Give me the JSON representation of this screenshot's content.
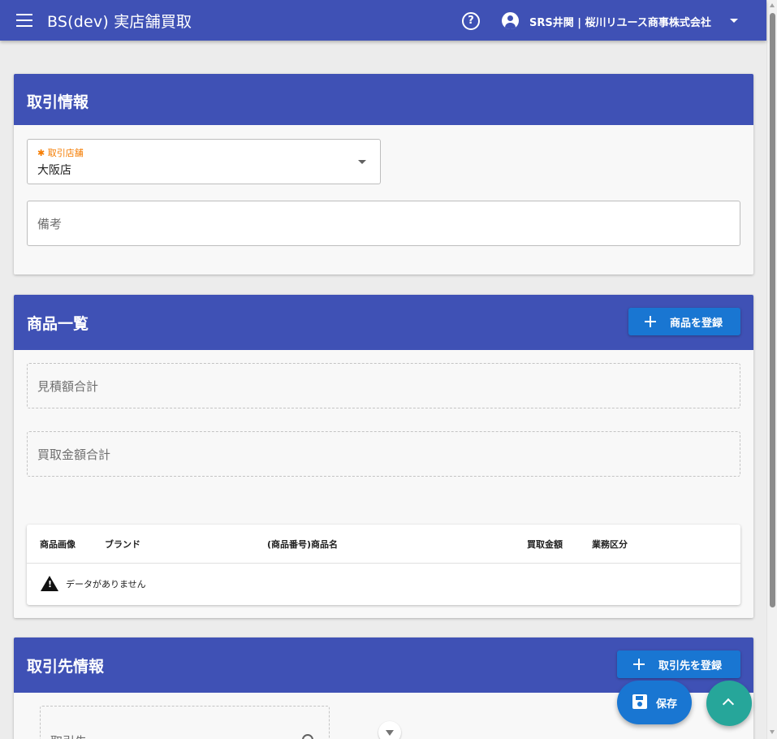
{
  "appbar": {
    "title": "BS(dev) 実店舗買取",
    "user_label": "SRS井関 | 桜川リユース商事株式会社",
    "color": "#3f51b5"
  },
  "transaction_info": {
    "title": "取引情報",
    "store_field": {
      "label": "取引店舗",
      "required_mark": "✱",
      "value": "大阪店"
    },
    "note_field": {
      "placeholder": "備考"
    }
  },
  "product_list": {
    "title": "商品一覧",
    "register_button": "商品を登録",
    "estimate_total": {
      "label": "見積額合計"
    },
    "purchase_total": {
      "label": "買取金額合計"
    },
    "table": {
      "columns": [
        "商品画像",
        "ブランド",
        "(商品番号)商品名",
        "買取金額",
        "業務区分"
      ],
      "empty_message": "データがありません"
    }
  },
  "partner_info": {
    "title": "取引先情報",
    "register_button": "取引先を登録",
    "partner_field": {
      "placeholder": "取引先"
    }
  },
  "fab": {
    "save_label": "保存",
    "save_color": "#1976d2",
    "top_color": "#26a69a"
  }
}
